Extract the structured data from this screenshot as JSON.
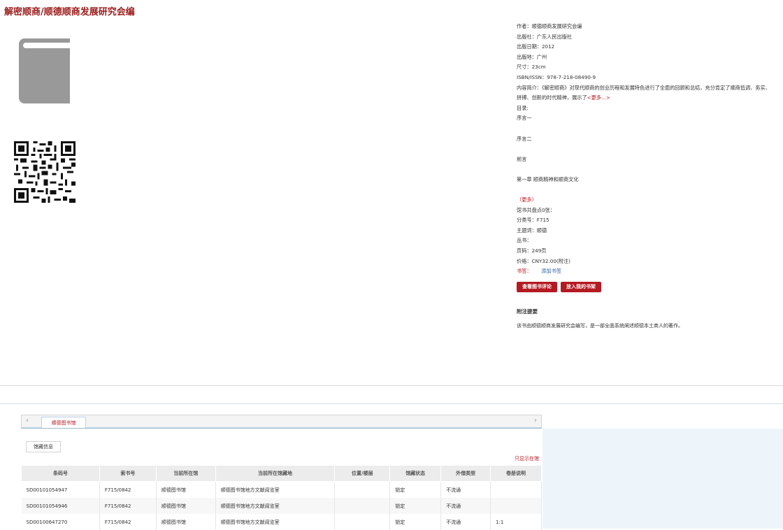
{
  "page_title": "解密顺商/顺德顺商发展研究会编",
  "meta": {
    "author": "作者：顺德顺商发展研究会编",
    "publisher": "出版社：广东人民出版社",
    "pub_date": "出版日期：2012",
    "pub_place": "出版地：广州",
    "size": "尺寸：23cm",
    "isbn": "ISBN/ISSN：978-7-218-08490-9",
    "summary_prefix": "内容简介：《解密顺商》对现代顺商的创业历程和发展特色进行了全面的回顾和总结，充分肯定了顺商低调、务实、拼搏、创新的时代精神，展示了",
    "summary_more": "<更多...>",
    "toc_label": "目录:",
    "toc_items": [
      "序言一",
      "序言二",
      "前言",
      "第一章 顺商精神和顺商文化"
    ],
    "toc_more": "（更多）",
    "collection_total": "馆书共盘点0张：",
    "class_no": "分类号：F715",
    "subject": "主题词：顺德",
    "series": "丛书：",
    "pages": "页码：249页",
    "price": "价格：CNY32.00(附注)",
    "shelf_label": "书签：",
    "shelf_link": "添加书签"
  },
  "buttons": {
    "view_reviews": "查看图书评论",
    "add_shelf": "放入我的书架"
  },
  "note": {
    "heading": "附注提要",
    "text": "该书由顺德顺商发展研究会编写，是一部全面系统阐述顺德本土商人的著作。"
  },
  "holdings": {
    "tab_library": "顺德图书馆",
    "subtab": "馆藏信息",
    "only_show": "只显示在馆",
    "columns": [
      "条码号",
      "索书号",
      "当前所在馆",
      "当前所在馆藏地",
      "位置/楼层",
      "馆藏状态",
      "外借类型",
      "卷册说明"
    ],
    "rows": [
      [
        "SD00101054947",
        "F715/0842",
        "顺德图书馆",
        "顺德图书馆地方文献阅览室",
        "",
        "锁定",
        "不流通",
        ""
      ],
      [
        "SD00101054946",
        "F715/0842",
        "顺德图书馆",
        "顺德图书馆地方文献阅览室",
        "",
        "锁定",
        "不流通",
        ""
      ],
      [
        "SD00100647270",
        "F715/0842",
        "顺德图书馆",
        "顺德图书馆地方文献阅览室",
        "",
        "锁定",
        "不流通",
        "1:1"
      ]
    ]
  },
  "icons": {
    "book": "book-cover-icon",
    "qr": "qr-code-icon",
    "prev": "chevron-left-icon",
    "next": "chevron-right-icon"
  }
}
